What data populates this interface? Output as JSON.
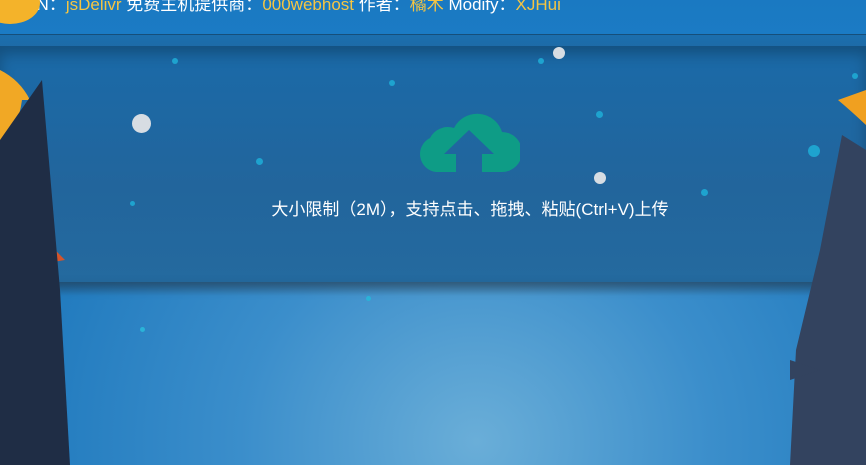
{
  "topbar": {
    "cdn_label": "球CDN：",
    "cdn_value": "jsDelivr",
    "host_label": " 免费主机提供商：",
    "host_value": "000webhost",
    "author_label": " 作者：",
    "author_value": "橘木",
    "modify_label": " Modify：",
    "modify_value": "XJHui"
  },
  "upload": {
    "icon": "cloud-upload-icon",
    "hint": "大小限制（2M），支持点击、拖拽、粘贴(Ctrl+V)上传"
  },
  "colors": {
    "accent_yellow": "#f5c542",
    "cloud_green": "#0e9c86",
    "panel": "#1f679f"
  }
}
